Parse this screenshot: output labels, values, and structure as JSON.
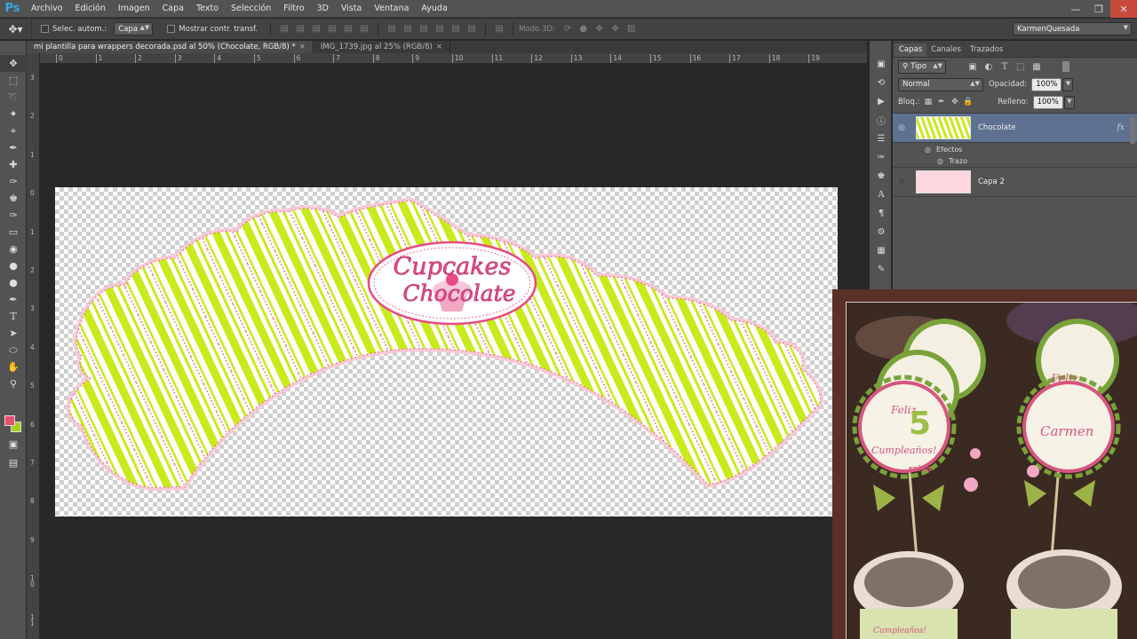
{
  "app": {
    "logo": "Ps"
  },
  "menu": [
    "Archivo",
    "Edición",
    "Imagen",
    "Capa",
    "Texto",
    "Selección",
    "Filtro",
    "3D",
    "Vista",
    "Ventana",
    "Ayuda"
  ],
  "options": {
    "auto_select_label": "Selec. autom.:",
    "auto_select_value": "Capa",
    "show_transform_label": "Mostrar contr. transf.",
    "mode_3d_label": "Modo 3D:",
    "workspace": "KarmenQuesada"
  },
  "tabs": [
    {
      "label": "mi plantilla para wrappers decorada.psd al 50% (Chocolate, RGB/8) *",
      "close": "×",
      "active": true
    },
    {
      "label": "IMG_1739.jpg al 25% (RGB/8)",
      "close": "×",
      "active": false
    }
  ],
  "ruler_h": [
    "0",
    "1",
    "2",
    "3",
    "4",
    "5",
    "6",
    "7",
    "8",
    "9",
    "10",
    "11",
    "12",
    "13",
    "14",
    "15",
    "16",
    "17",
    "18",
    "19"
  ],
  "ruler_v": [
    "3",
    "2",
    "1",
    "0",
    "1",
    "2",
    "3",
    "4",
    "5",
    "6",
    "7",
    "8",
    "9",
    "1\n0",
    "1\n1"
  ],
  "artwork": {
    "logo_line1": "Cupcakes",
    "logo_line2": "Chocolate",
    "stripe_color": "#c9ea1b",
    "dot_color": "#e0507a",
    "logo_pink": "#e84a86"
  },
  "layers_panel": {
    "tabs": [
      "Capas",
      "Canales",
      "Trazados"
    ],
    "filter": "Tipo",
    "blend_mode": "Normal",
    "opacity_label": "Opacidad:",
    "opacity": "100%",
    "lock_label": "Bloq.:",
    "fill_label": "Relleno:",
    "fill": "100%",
    "layers": [
      {
        "name": "Chocolate",
        "selected": true,
        "fx": "fx",
        "effects_label": "Efectos",
        "effect": "Trazo"
      },
      {
        "name": "Capa 2",
        "selected": false
      }
    ]
  },
  "photo": {
    "topper_texts": [
      "Feliz",
      "5",
      "Cumpleaños!",
      "raiva",
      "Carmen",
      "Feliz",
      "Cumpleaños!"
    ]
  },
  "colors": {
    "foreground": "#e84d6e",
    "background": "#a6d01a",
    "selection": "#5e7190"
  }
}
